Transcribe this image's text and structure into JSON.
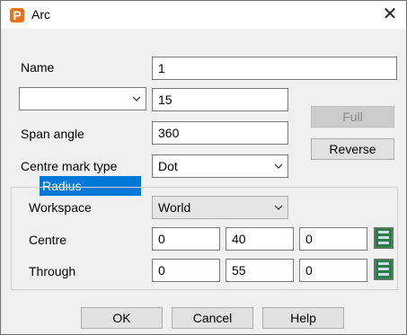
{
  "window": {
    "title": "Arc",
    "app_icon_letter": "P",
    "close_glyph": "✕"
  },
  "form": {
    "name_label": "Name",
    "name_value": "1",
    "mode_select": "Radius",
    "radius_value": "15",
    "span_label": "Span angle",
    "span_value": "360",
    "centre_mark_label": "Centre mark type",
    "centre_mark_value": "Dot"
  },
  "buttons": {
    "full": "Full",
    "reverse": "Reverse",
    "ok": "OK",
    "cancel": "Cancel",
    "help": "Help"
  },
  "workspace": {
    "label": "Workspace",
    "value": "World",
    "centre_label": "Centre",
    "centre": [
      "0",
      "40",
      "0"
    ],
    "through_label": "Through",
    "through": [
      "0",
      "55",
      "0"
    ]
  },
  "icons": {
    "chevron": "chevron-down-icon",
    "pick": "coordinate-pick-icon"
  }
}
